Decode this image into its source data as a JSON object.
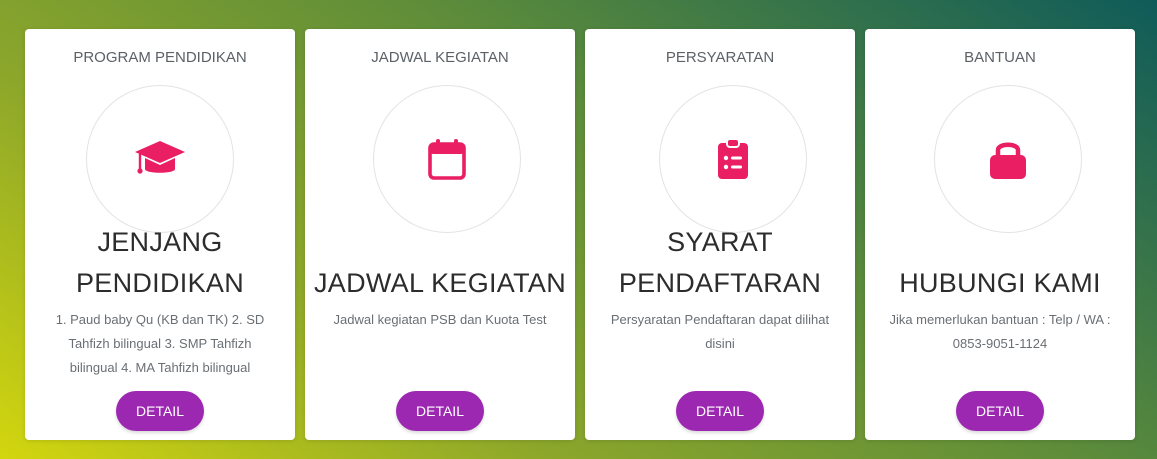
{
  "theme": {
    "accent": "#e91e63",
    "button": "#9c27b0"
  },
  "cards": [
    {
      "category": "PROGRAM PENDIDIKAN",
      "icon": "graduation-cap-icon",
      "title_line1": "JENJANG",
      "title_line2": "PENDIDIKAN",
      "description": "1. Paud baby Qu (KB dan TK) 2. SD Tahfizh bilingual 3. SMP Tahfizh bilingual 4. MA Tahfizh bilingual",
      "button": "DETAIL"
    },
    {
      "category": "JADWAL KEGIATAN",
      "icon": "calendar-icon",
      "title": "JADWAL KEGIATAN",
      "description": "Jadwal kegiatan PSB dan Kuota Test",
      "button": "DETAIL"
    },
    {
      "category": "PERSYARATAN",
      "icon": "clipboard-list-icon",
      "title_line1": "SYARAT",
      "title_line2": "PENDAFTARAN",
      "description": "Persyaratan Pendaftaran dapat dilihat disini",
      "button": "DETAIL"
    },
    {
      "category": "BANTUAN",
      "icon": "lock-icon",
      "title": "HUBUNGI KAMI",
      "description": "Jika memerlukan bantuan : Telp / WA : 0853-9051-1124",
      "button": "DETAIL"
    }
  ]
}
